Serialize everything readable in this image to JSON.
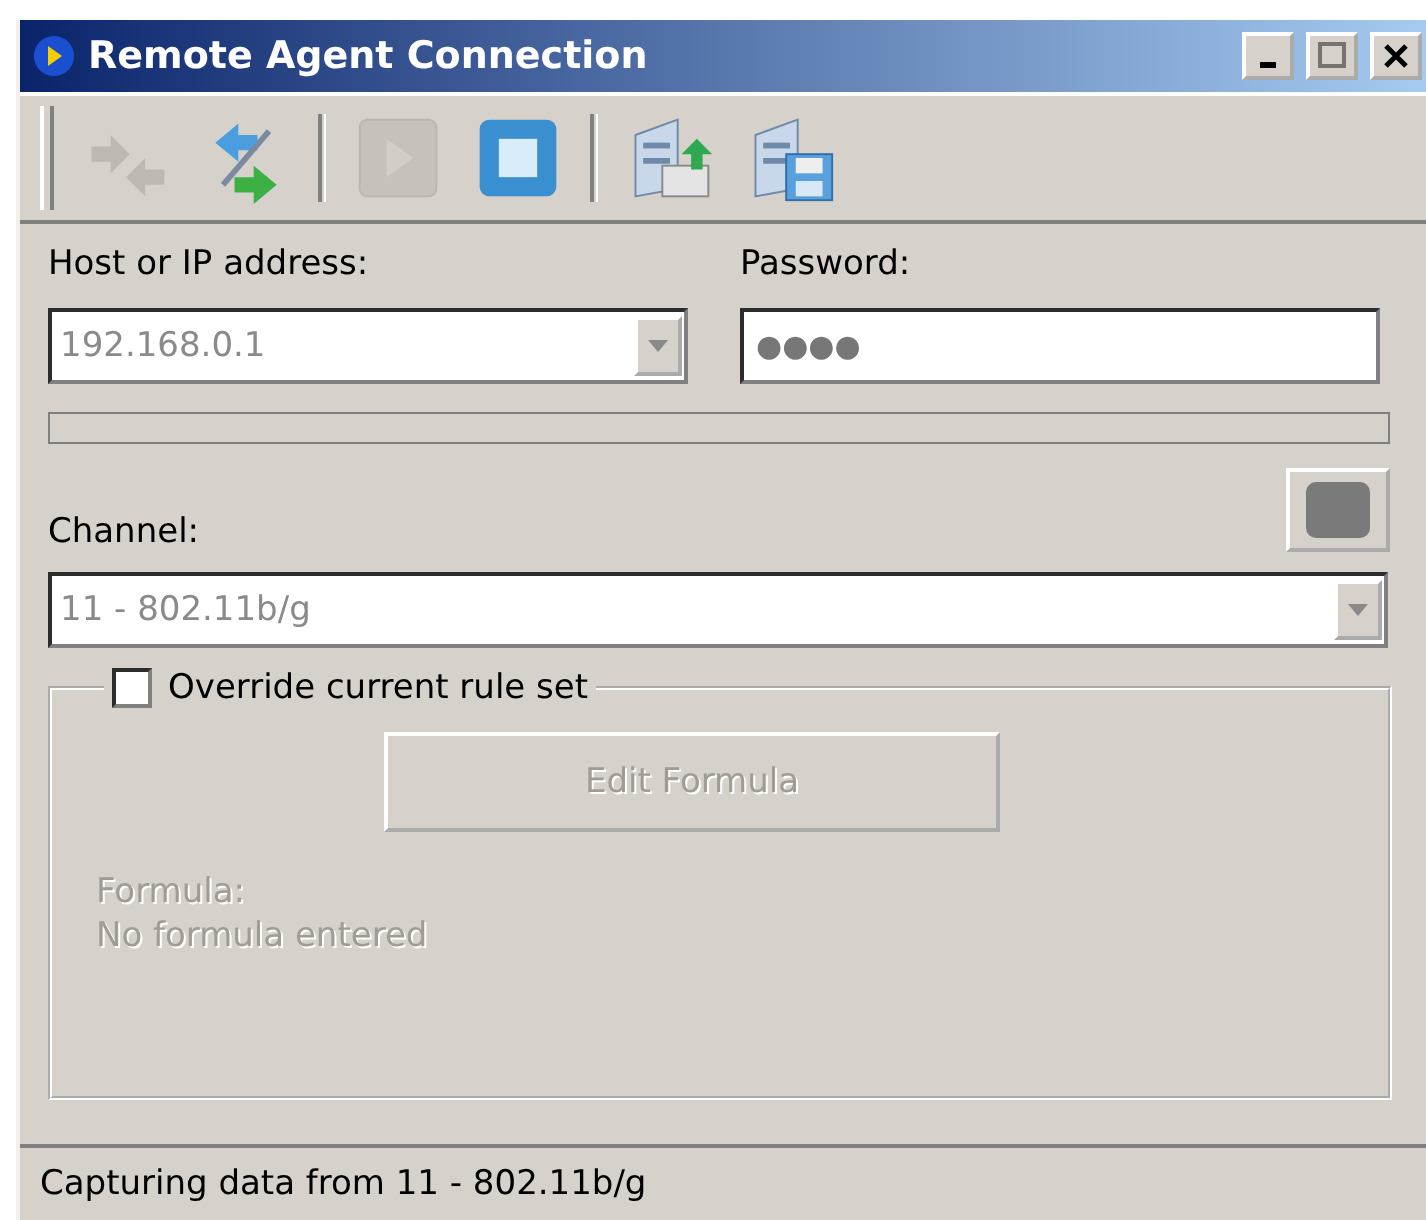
{
  "window": {
    "title": "Remote Agent Connection",
    "controls": [
      {
        "kind": "minimize",
        "disabled": false
      },
      {
        "kind": "maximize",
        "disabled": true
      },
      {
        "kind": "close",
        "disabled": false
      }
    ]
  },
  "toolbar": [
    {
      "kind": "connect",
      "disabled": true
    },
    {
      "kind": "disconnect",
      "disabled": false
    },
    {
      "kind": "separator"
    },
    {
      "kind": "play",
      "disabled": true
    },
    {
      "kind": "stop",
      "disabled": false
    },
    {
      "kind": "separator"
    },
    {
      "kind": "open",
      "disabled": false
    },
    {
      "kind": "save",
      "disabled": false
    }
  ],
  "host": {
    "label": "Host or IP address:",
    "value": "192.168.0.1",
    "disabled": true
  },
  "password": {
    "label": "Password:",
    "value": "●●●●"
  },
  "progress": {
    "level": 0
  },
  "channel": {
    "label": "Channel:",
    "value": "11 - 802.11b/g",
    "disabled": true
  },
  "override": {
    "label": "Override current rule set",
    "checked": false
  },
  "edit_formula": {
    "label": "Edit Formula",
    "disabled": true
  },
  "formula": {
    "label": "Formula:",
    "value": "No formula entered",
    "disabled": true
  },
  "status_bar": "Capturing data from 11 - 802.11b/g"
}
